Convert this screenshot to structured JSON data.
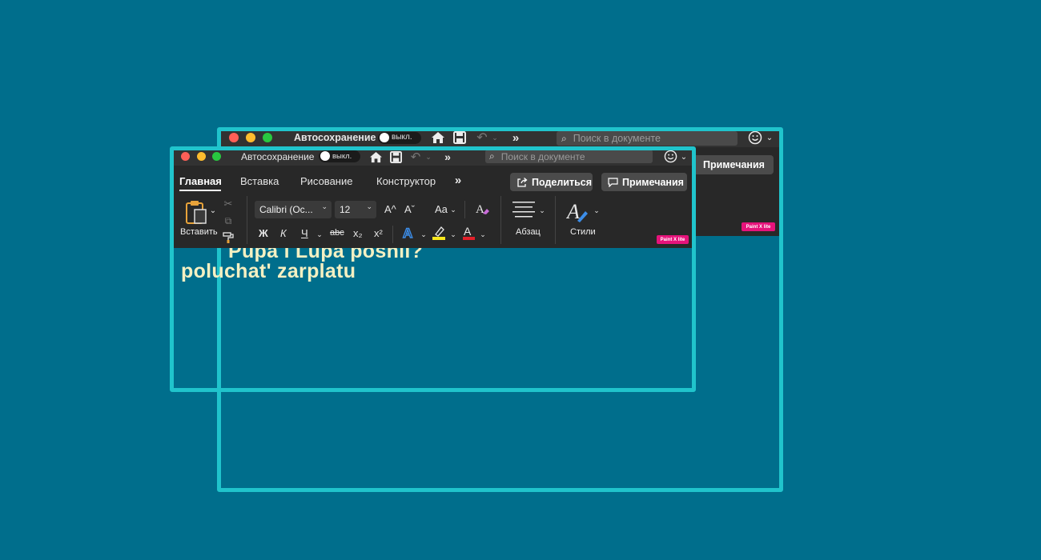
{
  "back_window": {
    "autosave_label": "Автосохранение",
    "autosave_state": "выкл.",
    "search_placeholder": "Поиск в документе",
    "comments_button": "Примечания",
    "badge": "Paint X lite"
  },
  "front_window": {
    "autosave_label": "Автосохранение",
    "autosave_state": "выкл.",
    "search_placeholder": "Поиск в документе",
    "tabs": [
      "Главная",
      "Вставка",
      "Рисование",
      "Конструктор"
    ],
    "active_tab": "Главная",
    "share_button": "Поделиться",
    "comments_button": "Примечания",
    "paste_label": "Вставить",
    "font_name": "Calibri (Ос...",
    "font_size": "12",
    "grow_font": "A^",
    "shrink_font": "Aˇ",
    "change_case": "Aa",
    "bold": "Ж",
    "italic": "К",
    "underline": "Ч",
    "strikethrough": "abc",
    "subscript": "x₂",
    "superscript": "x²",
    "paragraph_label": "Абзац",
    "styles_label": "Стили",
    "badge": "Paint X lite",
    "colors": {
      "highlight": "#f8e71c",
      "font_color": "#e3202a",
      "text_effects": "#3c8de8",
      "paste_icon": "#e8a33a",
      "accent_frame": "#20c4cc"
    }
  },
  "document": {
    "lines": [
      "Pupa i Lupa poshli?",
      "poluchat' zarplatu"
    ]
  }
}
